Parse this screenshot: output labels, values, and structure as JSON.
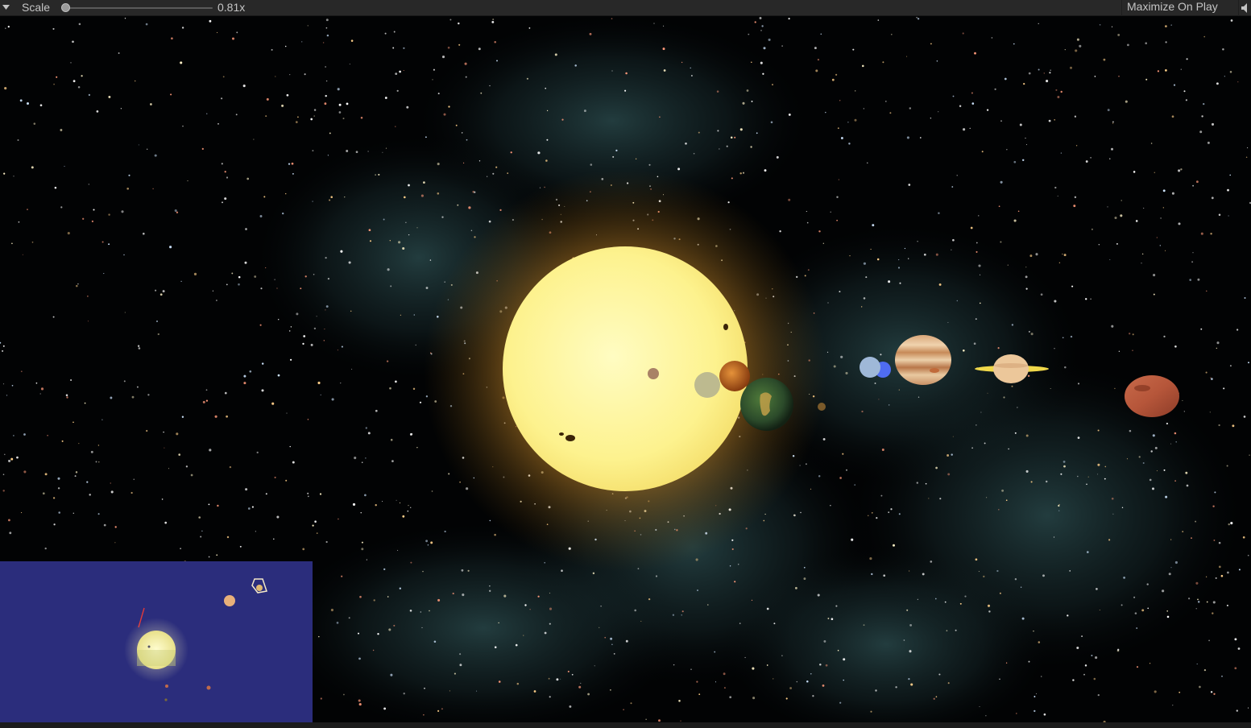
{
  "toolbar": {
    "menu_icon": "triangle-down-icon",
    "scale_label": "Scale",
    "scale_value_text": "0.81x",
    "scale_fraction": 0.0,
    "maximize_label": "Maximize On Play",
    "mute_icon": "speaker-icon"
  },
  "scene": {
    "background_color": "#020304",
    "nebula_color": "#3d6b6e",
    "sun_color": "#fdf59a",
    "sun_glow_color": "#f2b43c"
  },
  "minimap": {
    "background_color": "#2b2d7c"
  }
}
